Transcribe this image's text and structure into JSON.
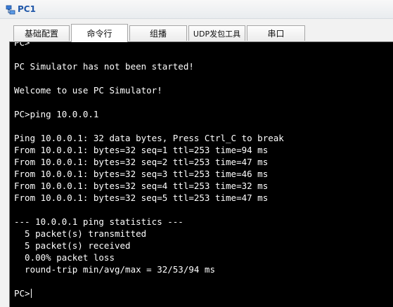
{
  "window": {
    "title": "PC1",
    "icon": "pc-network-icon"
  },
  "tabs": [
    {
      "label": "基础配置",
      "active": false
    },
    {
      "label": "命令行",
      "active": true
    },
    {
      "label": "组播",
      "active": false
    },
    {
      "label": "UDP发包工具",
      "active": false
    },
    {
      "label": "串口",
      "active": false
    }
  ],
  "terminal": {
    "lines": [
      "PC>",
      "",
      "PC Simulator has not been started!",
      "",
      "Welcome to use PC Simulator!",
      "",
      "PC>ping 10.0.0.1",
      "",
      "Ping 10.0.0.1: 32 data bytes, Press Ctrl_C to break",
      "From 10.0.0.1: bytes=32 seq=1 ttl=253 time=94 ms",
      "From 10.0.0.1: bytes=32 seq=2 ttl=253 time=47 ms",
      "From 10.0.0.1: bytes=32 seq=3 ttl=253 time=46 ms",
      "From 10.0.0.1: bytes=32 seq=4 ttl=253 time=32 ms",
      "From 10.0.0.1: bytes=32 seq=5 ttl=253 time=47 ms",
      "",
      "--- 10.0.0.1 ping statistics ---",
      "  5 packet(s) transmitted",
      "  5 packet(s) received",
      "  0.00% packet loss",
      "  round-trip min/avg/max = 32/53/94 ms",
      "",
      "PC>"
    ],
    "colors": {
      "background": "#000000",
      "text": "#ffffff"
    }
  },
  "colors": {
    "title_text": "#1f57a8",
    "window_bg": "#f2f2f2"
  }
}
